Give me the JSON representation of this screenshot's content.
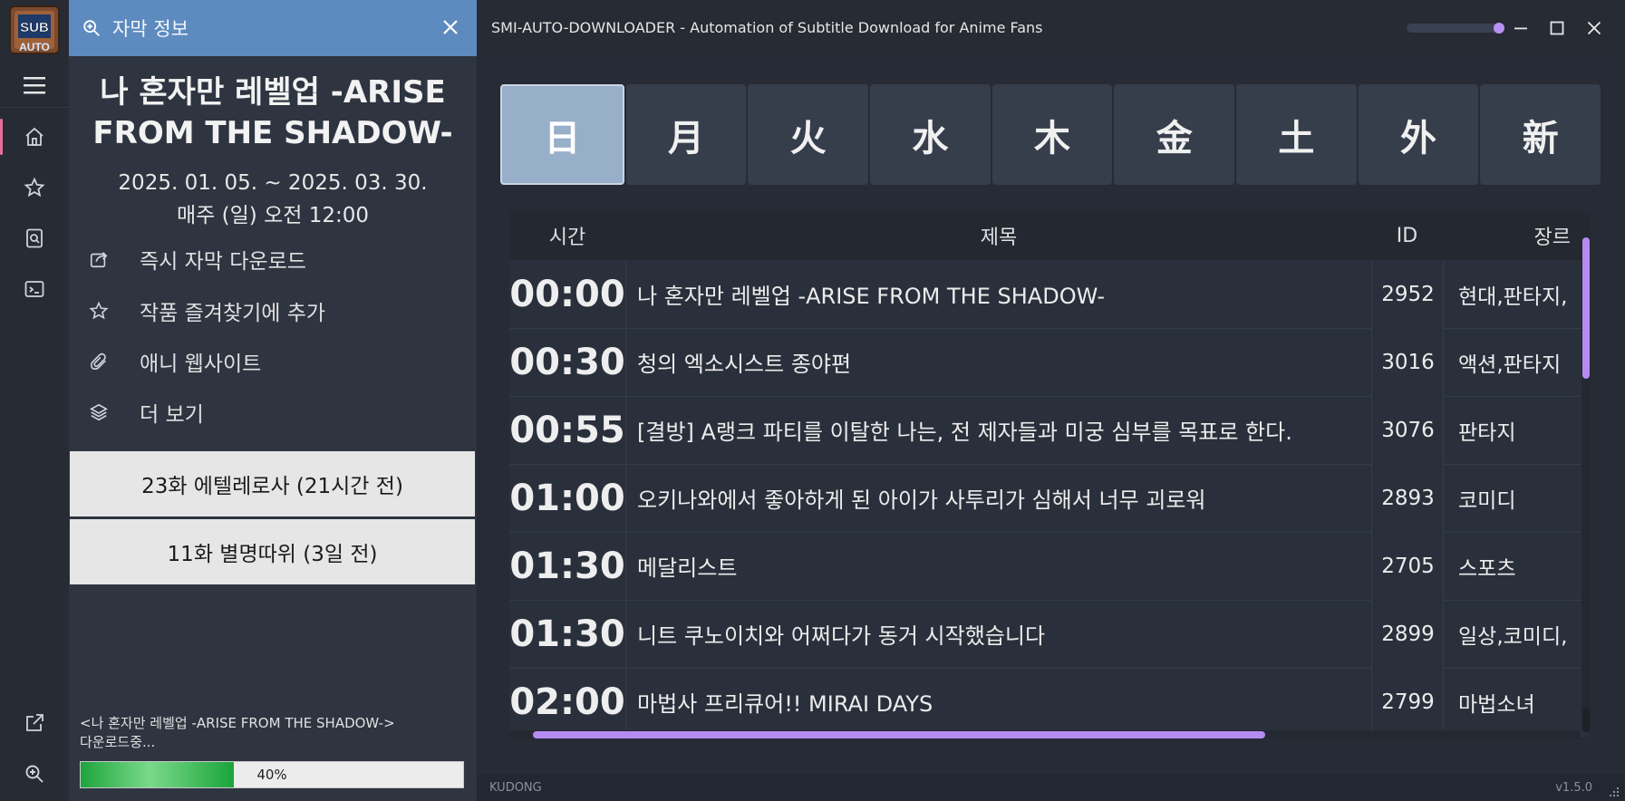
{
  "logo": {
    "top_text": "SUB",
    "bottom_text": "AUTO"
  },
  "nav": {
    "items": [
      {
        "icon": "menu-icon"
      },
      {
        "icon": "home-icon",
        "active": true
      },
      {
        "icon": "star-icon"
      },
      {
        "icon": "search-file-icon"
      },
      {
        "icon": "terminal-icon"
      }
    ],
    "bottom_items": [
      {
        "icon": "external-link-icon"
      },
      {
        "icon": "zoom-icon"
      }
    ]
  },
  "info_panel": {
    "header_title": "자막 정보",
    "anime_title": "나 혼자만 레벨업 -ARISE FROM THE SHADOW-",
    "date_range": "2025. 01. 05. ~ 2025. 03. 30.",
    "schedule": "매주 (일) 오전 12:00",
    "menu": [
      {
        "label": "즉시 자막 다운로드",
        "icon": "download-icon"
      },
      {
        "label": "작품 즐겨찾기에 추가",
        "icon": "star-icon"
      },
      {
        "label": "애니 웹사이트",
        "icon": "paperclip-icon"
      },
      {
        "label": "더 보기",
        "icon": "layers-icon"
      }
    ],
    "episodes": [
      {
        "label": "23화 에텔레로사 (21시간 전)"
      },
      {
        "label": "11화 별명따위 (3일 전)"
      }
    ],
    "download_status": {
      "line1": "<나 혼자만 레벨업 -ARISE FROM THE SHADOW->",
      "line2": "다운로드중...",
      "progress": 0.4,
      "progress_label": "40%"
    }
  },
  "titlebar": {
    "title": "SMI-AUTO-DOWNLOADER - Automation of Subtitle Download for Anime Fans",
    "opacity_slider_value": 1.0
  },
  "day_tabs": [
    {
      "label": "日",
      "active": true
    },
    {
      "label": "月"
    },
    {
      "label": "火"
    },
    {
      "label": "水"
    },
    {
      "label": "木"
    },
    {
      "label": "金"
    },
    {
      "label": "土"
    },
    {
      "label": "外"
    },
    {
      "label": "新"
    }
  ],
  "table": {
    "headers": {
      "time": "시간",
      "title": "제목",
      "id": "ID",
      "genre": "장르"
    },
    "rows": [
      {
        "time": "00:00",
        "title": "나 혼자만 레벨업 -ARISE FROM THE SHADOW-",
        "id": "2952",
        "genre": "현대,판타지,"
      },
      {
        "time": "00:30",
        "title": "청의 엑소시스트 종야편",
        "id": "3016",
        "genre": "액션,판타지"
      },
      {
        "time": "00:55",
        "title": "[결방] A랭크 파티를 이탈한 나는, 전 제자들과 미궁 심부를 목표로 한다.",
        "id": "3076",
        "genre": "판타지"
      },
      {
        "time": "01:00",
        "title": "오키나와에서 좋아하게 된 아이가 사투리가 심해서 너무 괴로워",
        "id": "2893",
        "genre": "코미디"
      },
      {
        "time": "01:30",
        "title": "메달리스트",
        "id": "2705",
        "genre": "스포츠"
      },
      {
        "time": "01:30",
        "title": "니트 쿠노이치와 어쩌다가 동거 시작했습니다",
        "id": "2899",
        "genre": "일상,코미디,"
      },
      {
        "time": "02:00",
        "title": "마법사 프리큐어!! MIRAI DAYS",
        "id": "2799",
        "genre": "마법소녀"
      }
    ]
  },
  "statusbar": {
    "left": "KUDONG",
    "right": "v1.5.0"
  },
  "colors": {
    "accent": "#b58bf2",
    "header_blue": "#5d8bbf",
    "active_tab": "#97afc8",
    "progress_green": "#1ea53d"
  }
}
